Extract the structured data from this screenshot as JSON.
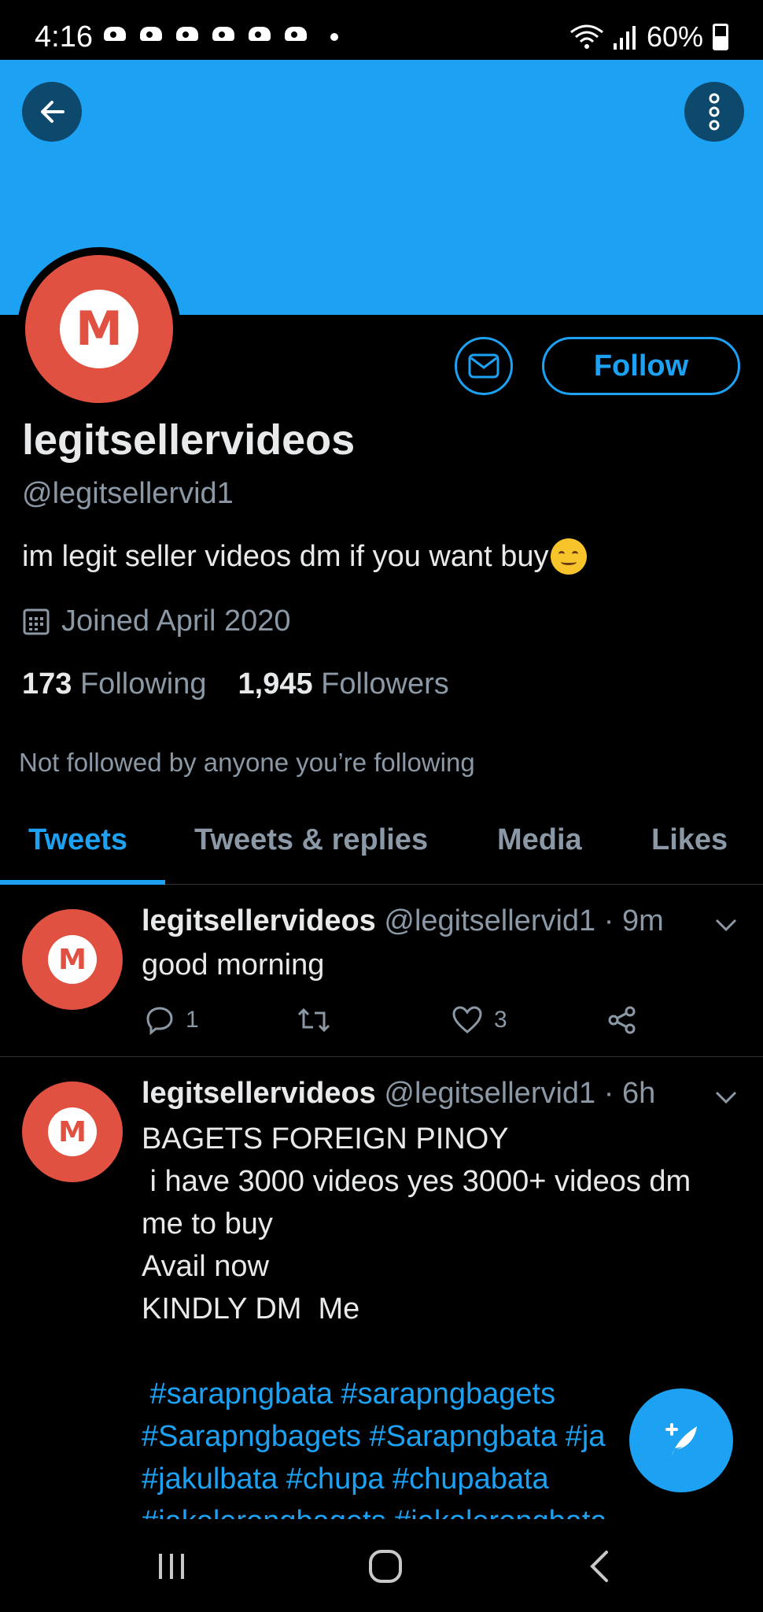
{
  "status_bar": {
    "time": "4:16",
    "battery": "60%"
  },
  "profile": {
    "name": "legitsellervideos",
    "handle": "@legitsellervid1",
    "bio": "im legit seller videos dm if you want buy",
    "joined": "Joined April 2020",
    "following_count": "173",
    "following_label": "Following",
    "followers_count": "1,945",
    "followers_label": "Followers",
    "not_followed": "Not followed by anyone you’re following",
    "avatar_letter": "M",
    "follow_label": "Follow"
  },
  "tabs": [
    {
      "label": "Tweets",
      "active": true
    },
    {
      "label": "Tweets & replies",
      "active": false
    },
    {
      "label": "Media",
      "active": false
    },
    {
      "label": "Likes",
      "active": false
    }
  ],
  "tweets": [
    {
      "name": "legitsellervideos",
      "meta": "@legitsellervid1 · 9m",
      "text": "good morning",
      "replies": "1",
      "likes": "3"
    },
    {
      "name": "legitsellervideos",
      "meta": "@legitsellervid1 · 6h",
      "lines": [
        "BAGETS FOREIGN PINOY",
        " i have 3000 videos yes 3000+ videos dm",
        "me to buy",
        "Avail now",
        "KINDLY DM  Me"
      ],
      "hashtag_lines": [
        " #sarapngbata #sarapngbagets",
        "#Sarapngbagets #Sarapngbata #ja",
        "#jakulbata #chupa #chupabata",
        "#jakolerongbagets #jakolerongbata"
      ]
    }
  ],
  "colors": {
    "accent": "#1da1f2",
    "avatar_red": "#e15141",
    "muted": "#8b98a5"
  }
}
